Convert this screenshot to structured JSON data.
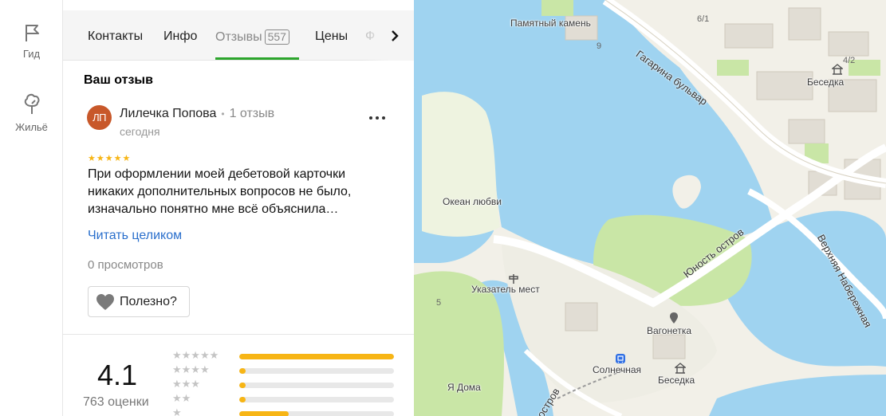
{
  "rail": {
    "guide_label": "Гид",
    "housing_label": "Жильё"
  },
  "tabs": {
    "contacts": "Контакты",
    "info": "Инфо",
    "reviews": "Отзывы",
    "reviews_count": "557",
    "prices": "Цены",
    "photos": "Ф"
  },
  "review_section": {
    "title": "Ваш отзыв",
    "avatar_initials": "ЛП",
    "author_name": "Лилечка Попова",
    "author_reviews": "1 отзыв",
    "date": "сегодня",
    "stars": 5,
    "text": "При оформлении моей дебетовой карточки никаких дополнительных вопросов не было, изначально понятно мне всё объяснила…",
    "read_more": "Читать целиком",
    "views": "0 просмотров",
    "useful_label": "Полезно?"
  },
  "summary": {
    "rating": "4.1",
    "ratings_count": "763 оценки",
    "distribution": [
      {
        "stars": 5,
        "fraction": 1.0
      },
      {
        "stars": 4,
        "fraction": 0.04
      },
      {
        "stars": 3,
        "fraction": 0.04
      },
      {
        "stars": 2,
        "fraction": 0.04
      },
      {
        "stars": 1,
        "fraction": 0.32
      }
    ]
  },
  "map": {
    "labels": {
      "memorial_stone": "Памятный камень",
      "gagarin_blvd": "Гагарина бульвар",
      "gazebo1": "Беседка",
      "ocean_love": "Океан любви",
      "signpost": "Указатель мест",
      "yunost": "Юность остров",
      "upper_emb": "Верхняя Набережная",
      "trolley": "Вагонетка",
      "solnechnaya": "Солнечная",
      "gazebo2": "Беседка",
      "ya_doma": "Я Дома",
      "bottom_road": "остров",
      "num_9": "9",
      "num_6_1": "6/1",
      "num_4_2": "4/2",
      "num_5": "5"
    },
    "colors": {
      "water": "#9fd3f0",
      "land": "#f2f0e8",
      "park": "#c9e6a6",
      "building": "#e1ddd4",
      "road": "#ffffff",
      "accent_green": "#2ca52c",
      "star_yellow": "#f7b515"
    }
  }
}
